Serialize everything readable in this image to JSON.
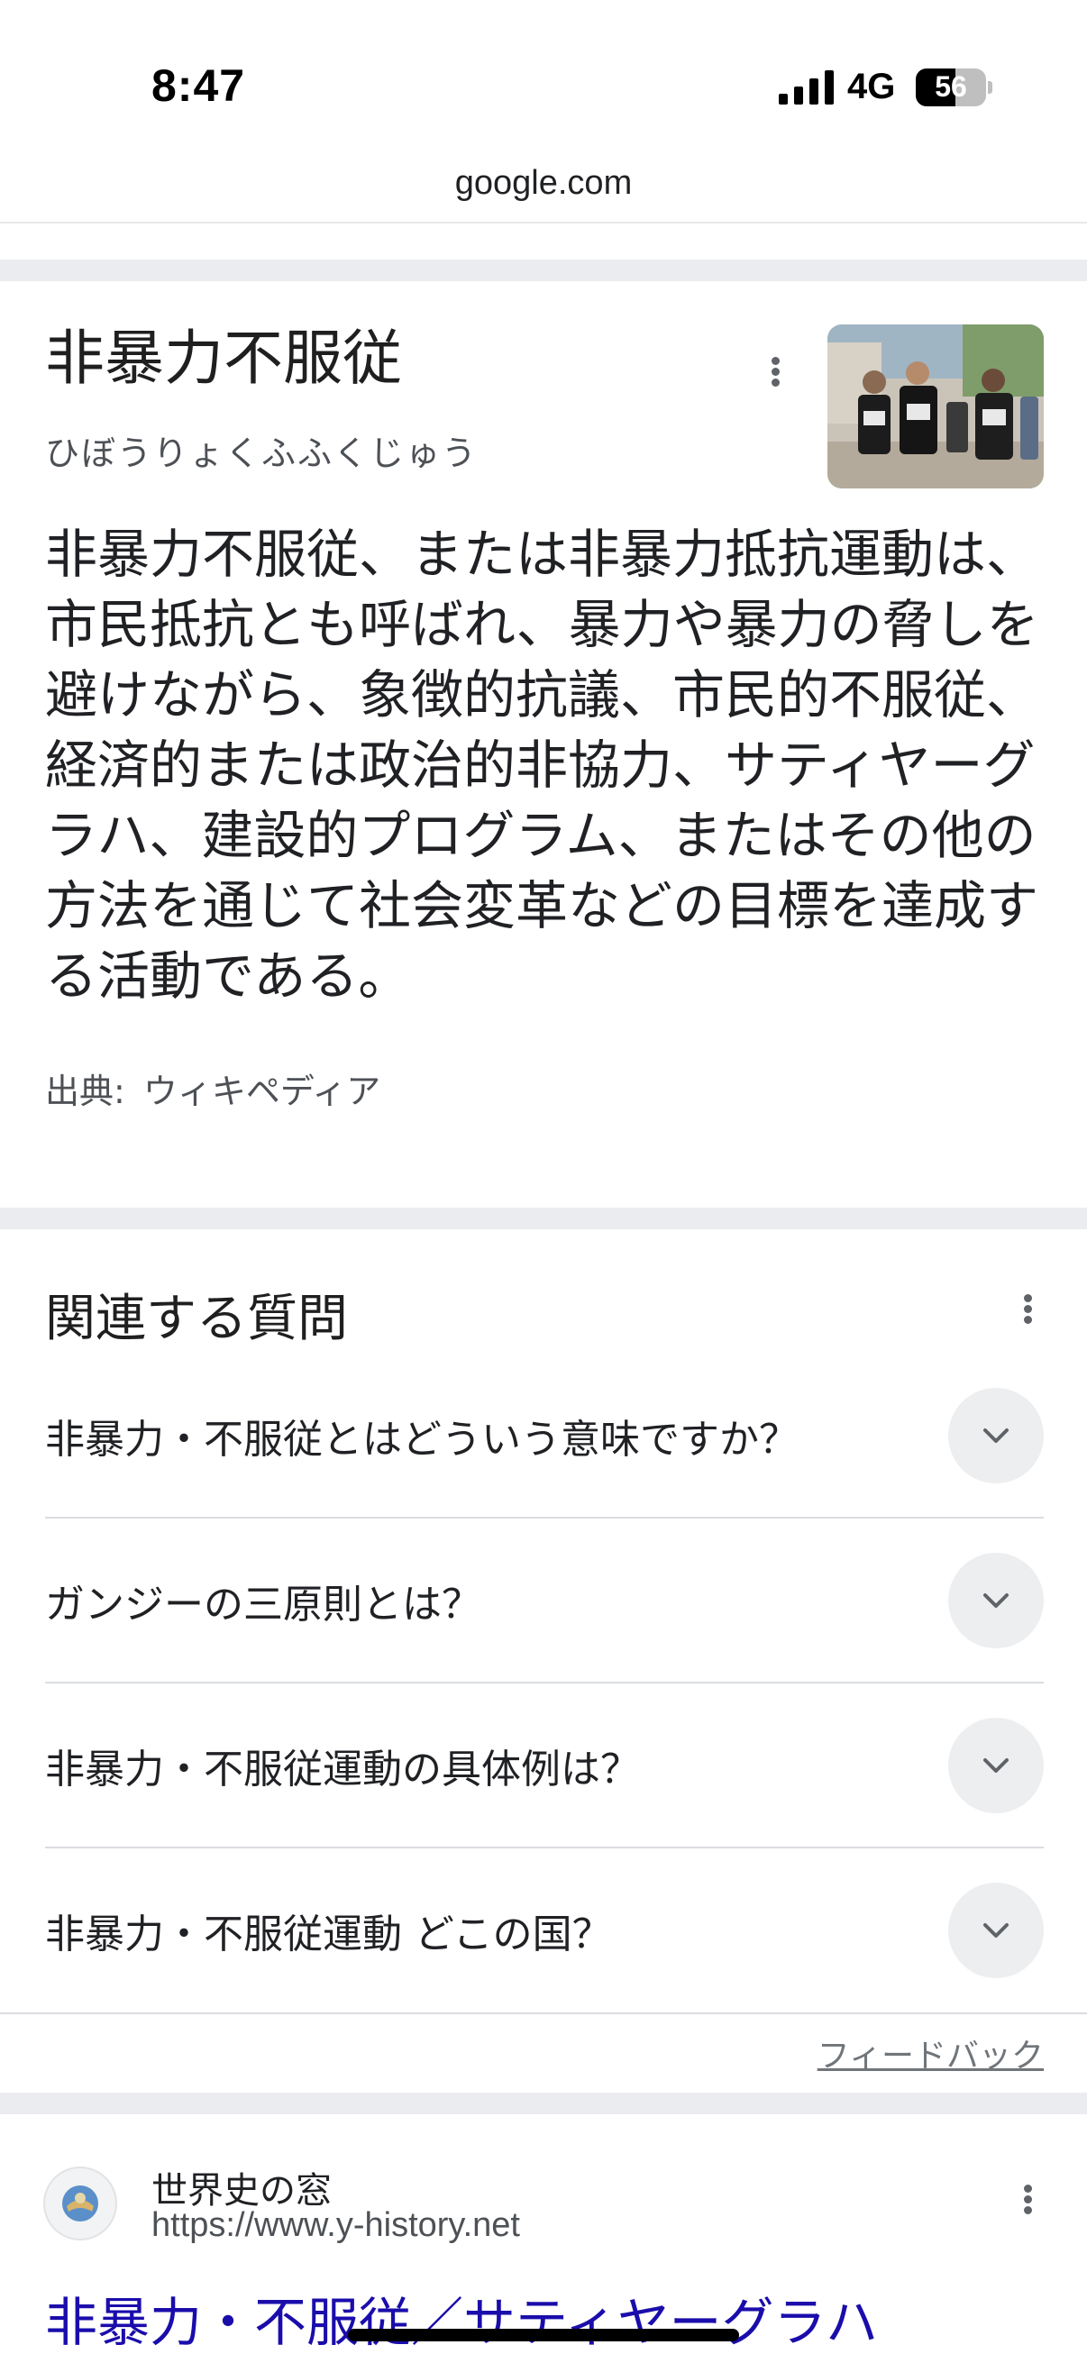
{
  "status_bar": {
    "time": "8:47",
    "network": "4G",
    "battery_level": "56",
    "battery_fraction": 0.56
  },
  "browser": {
    "url": "google.com"
  },
  "knowledge_panel": {
    "title": "非暴力不服従",
    "reading": "ひぼうりょくふふくじゅう",
    "description": "非暴力不服従、または非暴力抵抗運動は、市民抵抗とも呼ばれ、暴力や暴力の脅しを避けながら、象徴的抗議、市民的不服従、経済的または政治的非協力、サティヤーグラハ、建設的プログラム、またはその他の方法を通じて社会変革などの目標を達成する活動である。",
    "source_label": "出典:",
    "source_name": "ウィキペディア",
    "image_icon": "protest-photo"
  },
  "related_questions": {
    "heading": "関連する質問",
    "items": [
      {
        "label": "非暴力・不服従とはどういう意味ですか？"
      },
      {
        "label": "ガンジーの三原則とは？"
      },
      {
        "label": "非暴力・不服従運動の具体例は？"
      },
      {
        "label": "非暴力・不服従運動 どこの国？"
      }
    ],
    "feedback": "フィードバック"
  },
  "result": {
    "site_name": "世界史の窓",
    "site_url": "https://www.y-history.net",
    "title": "非暴力・不服従／サティヤーグラハ"
  },
  "colors": {
    "link": "#1a0dab",
    "band": "#ebecef"
  }
}
